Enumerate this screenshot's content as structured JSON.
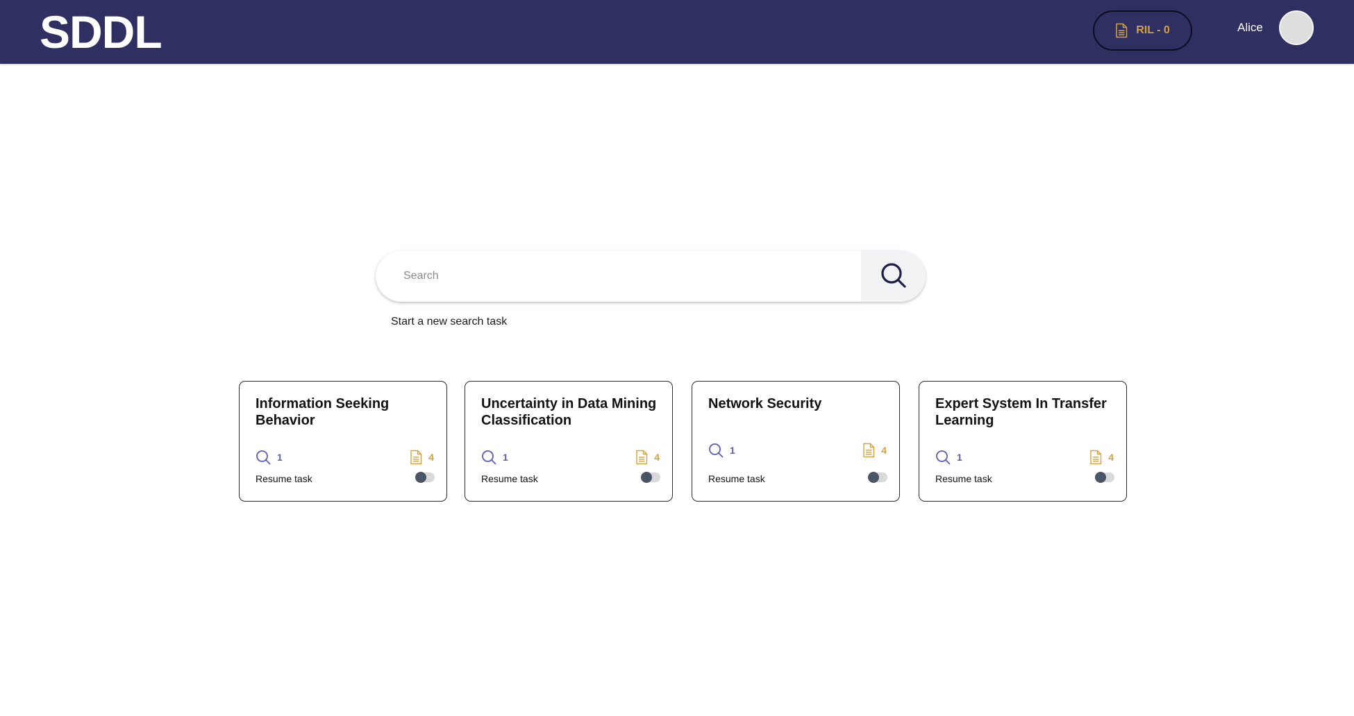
{
  "header": {
    "logo": "SDDL",
    "ril_label": "RIL - 0",
    "username": "Alice"
  },
  "search": {
    "placeholder": "Search",
    "hint": "Start a new search task"
  },
  "tasks": [
    {
      "title": "Information Seeking Behavior",
      "queries": "1",
      "documents": "4",
      "resume_label": "Resume task"
    },
    {
      "title": "Uncertainty in Data Mining Classification",
      "queries": "1",
      "documents": "4",
      "resume_label": "Resume task"
    },
    {
      "title": "Network Security",
      "queries": "1",
      "documents": "4",
      "resume_label": "Resume task"
    },
    {
      "title": "Expert System In Transfer Learning",
      "queries": "1",
      "documents": "4",
      "resume_label": "Resume task"
    }
  ],
  "icons": {
    "search": "search-icon",
    "document": "document-icon",
    "toggle": "toggle-switch"
  },
  "colors": {
    "header_bg": "#2f2f62",
    "accent_gold": "#d4a23c",
    "query_purple": "#5b5bb0"
  }
}
